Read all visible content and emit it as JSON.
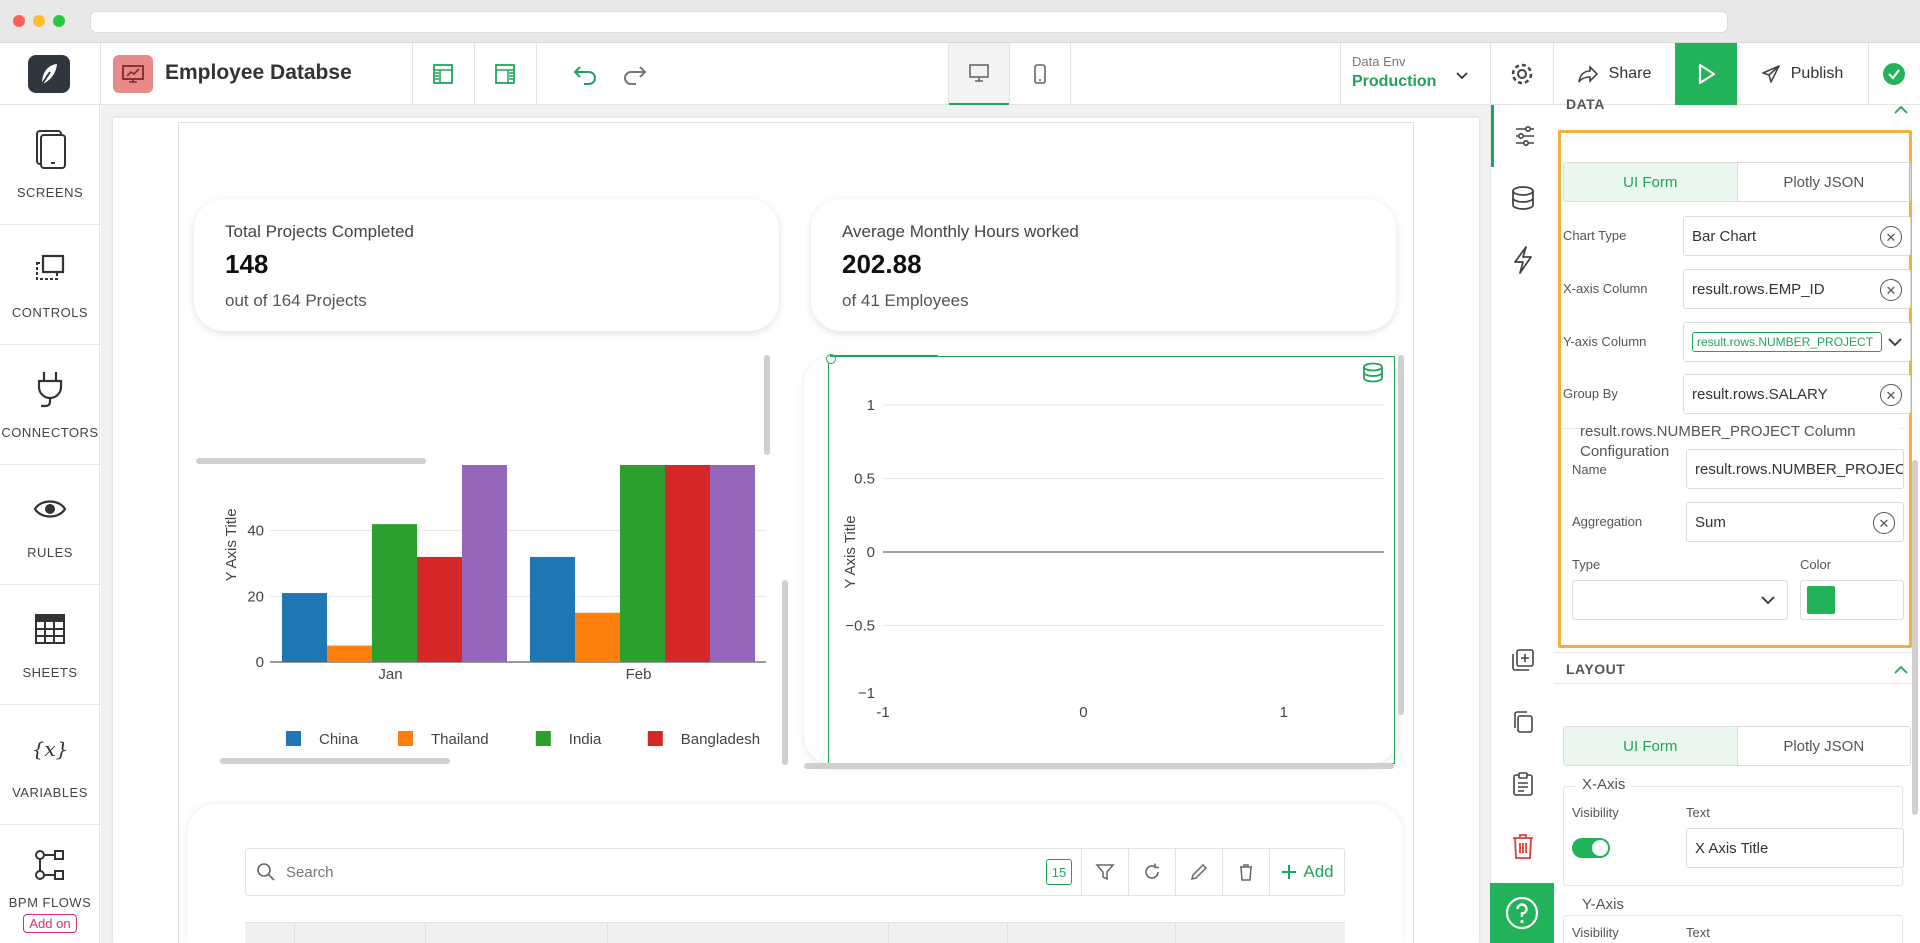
{
  "app": {
    "title": "Employee Databse",
    "env_label": "Data Env",
    "env_value": "Production",
    "share_label": "Share",
    "publish_label": "Publish"
  },
  "sidebar": {
    "items": [
      {
        "label": "SCREENS",
        "icon": "tablet-icon"
      },
      {
        "label": "CONTROLS",
        "icon": "controls-icon"
      },
      {
        "label": "CONNECTORS",
        "icon": "plug-icon"
      },
      {
        "label": "RULES",
        "icon": "eye-icon"
      },
      {
        "label": "SHEETS",
        "icon": "table-icon"
      },
      {
        "label": "VARIABLES",
        "icon": "variable-icon"
      },
      {
        "label": "BPM FLOWS",
        "icon": "flow-icon"
      }
    ],
    "addon_label": "Add on"
  },
  "stats": [
    {
      "title": "Total Projects Completed",
      "value": "148",
      "sub": "out of 164 Projects"
    },
    {
      "title": "Average Monthly Hours worked",
      "value": "202.88",
      "sub": "of 41 Employees"
    }
  ],
  "chart_data": [
    {
      "type": "bar",
      "categories": [
        "Jan",
        "Feb"
      ],
      "series": [
        {
          "name": "China",
          "values": [
            21,
            32
          ]
        },
        {
          "name": "Thailand",
          "values": [
            5,
            15
          ]
        },
        {
          "name": "India",
          "values": [
            42,
            60
          ]
        },
        {
          "name": "Bangladesh",
          "values": [
            32,
            60
          ]
        },
        {
          "name": "",
          "values": [
            60,
            60
          ]
        }
      ],
      "colors": [
        "#1f77b4",
        "#ff7f0e",
        "#2ca02c",
        "#d62728",
        "#9467bd"
      ],
      "ylabel": "Y Axis Title",
      "ylim": [
        0,
        60
      ],
      "yticks": [
        "0",
        "20",
        "40"
      ],
      "legend": "bottom"
    },
    {
      "type": "line",
      "series": [],
      "ylabel": "Y Axis Title",
      "xlim": [
        -1,
        1.5
      ],
      "ylim": [
        -1,
        1
      ],
      "xticks": [
        "-1",
        "0",
        "1"
      ],
      "yticks": [
        "1",
        "0.5",
        "0",
        "−0.5",
        "−1"
      ]
    }
  ],
  "table": {
    "search_placeholder": "Search",
    "count": "15",
    "add_label": "Add"
  },
  "props": {
    "data_header": "DATA",
    "tabs": [
      "UI Form",
      "Plotly JSON"
    ],
    "chart_type_label": "Chart Type",
    "chart_type_value": "Bar Chart",
    "x_axis_label": "X-axis Column",
    "x_axis_value": "result.rows.EMP_ID",
    "y_axis_label": "Y-axis Column",
    "y_axis_chip": "result.rows.NUMBER_PROJECT",
    "group_by_label": "Group By",
    "group_by_value": "result.rows.SALARY",
    "column_config_title": "result.rows.NUMBER_PROJECT Column Configuration",
    "name_label": "Name",
    "name_value": "result.rows.NUMBER_PROJECT",
    "aggregation_label": "Aggregation",
    "aggregation_value": "Sum",
    "type_label": "Type",
    "color_label": "Color",
    "color_value": "#22b35a",
    "layout_header": "LAYOUT",
    "layout_tabs": [
      "UI Form",
      "Plotly JSON"
    ],
    "xaxis_group": "X-Axis",
    "visibility_label": "Visibility",
    "text_label": "Text",
    "xaxis_text": "X Axis Title",
    "yaxis_group": "Y-Axis",
    "yaxis_visibility_label": "Visibility",
    "yaxis_text_label": "Text"
  }
}
